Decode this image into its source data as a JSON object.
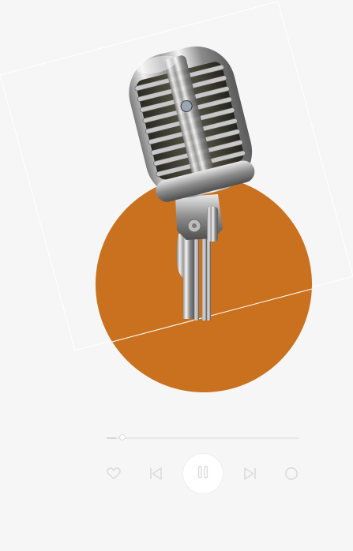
{
  "artwork": {
    "accent_color": "#c9711f",
    "background_color": "#f6f6f6",
    "subject_icon": "vintage-microphone"
  },
  "player": {
    "progress_fraction": 0.05,
    "icon_color": "#dadada",
    "controls": {
      "like": "heart-icon",
      "previous": "skip-previous-icon",
      "play_pause": "pause-icon",
      "next": "skip-next-icon",
      "extra": "circle-icon"
    }
  }
}
